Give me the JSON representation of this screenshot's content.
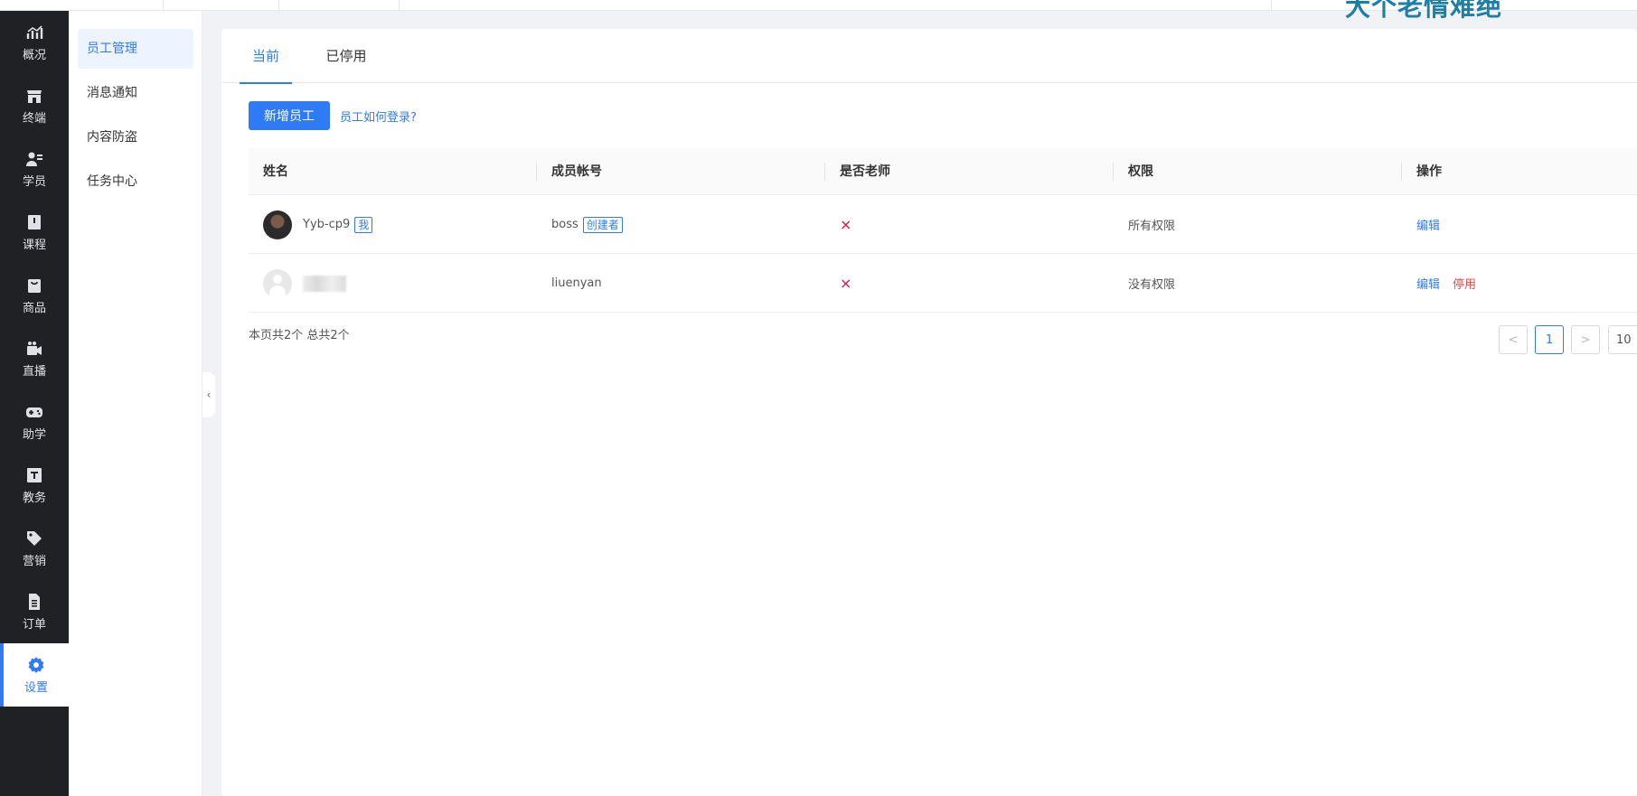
{
  "banner": {
    "text": "大个老情难绝"
  },
  "rail": {
    "items": [
      {
        "label": "概况",
        "icon": "chart-icon"
      },
      {
        "label": "终端",
        "icon": "store-icon"
      },
      {
        "label": "学员",
        "icon": "students-icon"
      },
      {
        "label": "课程",
        "icon": "book-icon"
      },
      {
        "label": "商品",
        "icon": "bag-icon"
      },
      {
        "label": "直播",
        "icon": "video-icon"
      },
      {
        "label": "助学",
        "icon": "gamepad-icon"
      },
      {
        "label": "教务",
        "icon": "calendar-icon"
      },
      {
        "label": "营销",
        "icon": "tag-icon"
      },
      {
        "label": "订单",
        "icon": "document-icon"
      },
      {
        "label": "设置",
        "icon": "gear-icon"
      }
    ],
    "active_index": 10,
    "active_color": "#2f7bf5"
  },
  "subnav": {
    "items": [
      {
        "label": "员工管理"
      },
      {
        "label": "消息通知"
      },
      {
        "label": "内容防盗"
      },
      {
        "label": "任务中心"
      }
    ],
    "active_index": 0
  },
  "tabs": [
    {
      "label": "当前"
    },
    {
      "label": "已停用"
    }
  ],
  "toolbar": {
    "add_label": "新增员工",
    "help_link": "员工如何登录?"
  },
  "table": {
    "headers": [
      "姓名",
      "成员帐号",
      "是否老师",
      "权限",
      "操作"
    ],
    "rows": [
      {
        "name": "Yyb-cp9",
        "name_tag": "我",
        "account": "boss",
        "account_tag": "创建者",
        "is_teacher": "×",
        "permission": "所有权限",
        "actions": [
          "编辑"
        ]
      },
      {
        "name": "",
        "name_tag": "",
        "account": "liuenyan",
        "account_tag": "",
        "is_teacher": "×",
        "permission": "没有权限",
        "actions": [
          "编辑",
          "停用"
        ]
      }
    ]
  },
  "footer": {
    "summary": "本页共2个 总共2个",
    "prev": "<",
    "page": "1",
    "next": ">",
    "page_size": "10"
  },
  "collapse_glyph": "‹"
}
